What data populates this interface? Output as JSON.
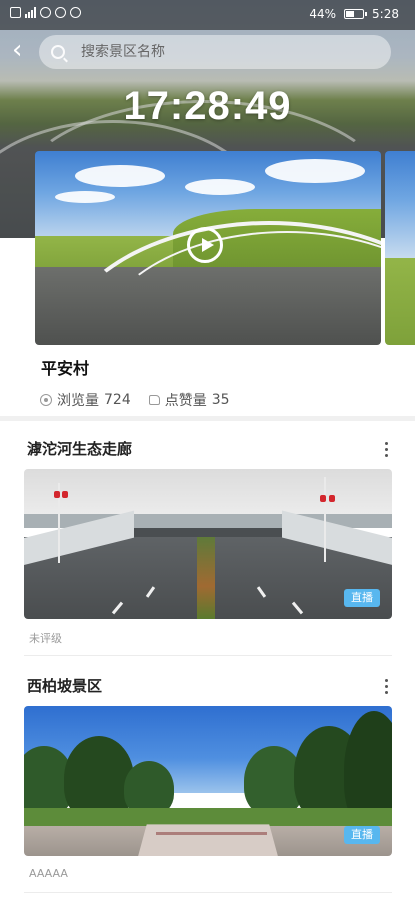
{
  "status_bar": {
    "battery": "44%",
    "time": "5:28"
  },
  "search": {
    "placeholder": "搜索景区名称"
  },
  "clock": "17:28:49",
  "featured": {
    "title": "平安村",
    "views_label": "浏览量",
    "views": "724",
    "likes_label": "点赞量",
    "likes": "35"
  },
  "list": [
    {
      "title": "滹沱河生态走廊",
      "badge": "直播",
      "rating": "未评级"
    },
    {
      "title": "西柏坡景区",
      "badge": "直播",
      "rating": "AAAAA"
    }
  ],
  "icons": [
    "back-icon",
    "search-icon",
    "play-icon",
    "eye-icon",
    "thumb-up-icon",
    "more-icon"
  ]
}
